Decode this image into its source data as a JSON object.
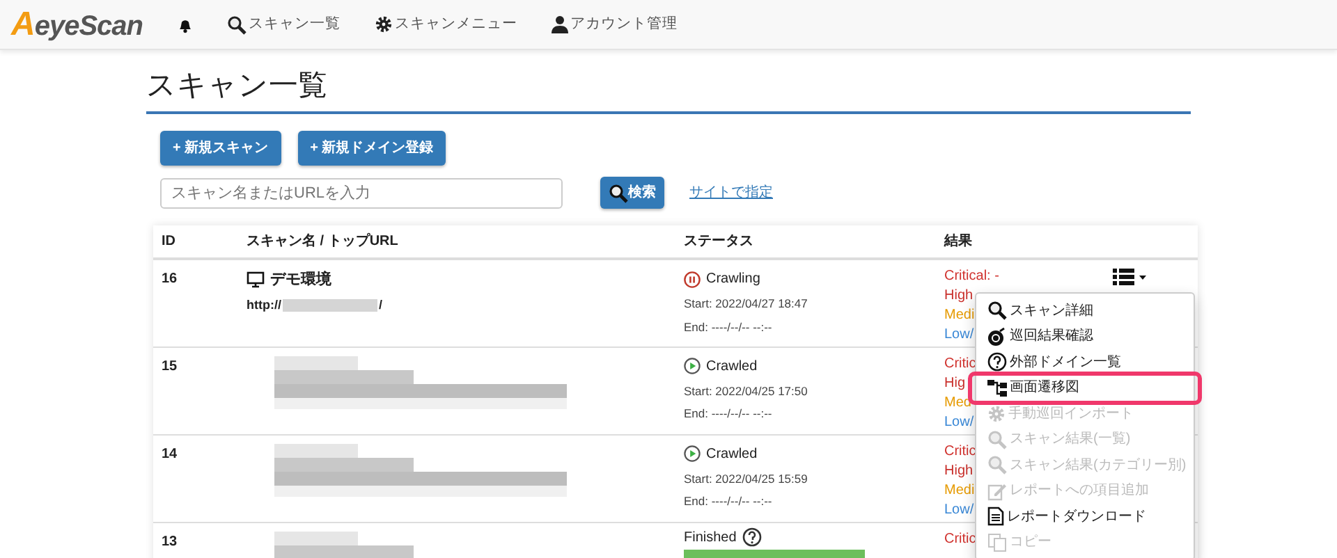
{
  "navbar": {
    "brand_mark": "A",
    "brand_rest": "eyeScan",
    "items": [
      {
        "label": "スキャン一覧"
      },
      {
        "label": "スキャンメニュー"
      },
      {
        "label": "アカウント管理"
      }
    ]
  },
  "page_title": "スキャン一覧",
  "buttons": [
    "+ 新規スキャン",
    "+ 新規ドメイン登録"
  ],
  "search": {
    "placeholder": "スキャン名またはURLを入力",
    "button": "検索",
    "link": "サイトで指定"
  },
  "table": {
    "columns": [
      "ID",
      "スキャン名 / トップURL",
      "ステータス",
      "結果"
    ],
    "rows": [
      {
        "id": "16",
        "name": "デモ環境",
        "url_prefix": "http://",
        "url_suffix": "/",
        "status": "Crawling",
        "kind": "paused",
        "start": "Start: 2022/04/27 18:47",
        "end": "End: ----/--/-- --:--",
        "results": [
          {
            "text": "Critical: -",
            "color": "#d0312d"
          },
          {
            "text": "High",
            "color": "#c9302c"
          },
          {
            "text": "Medi",
            "color": "#e69a00"
          },
          {
            "text": "Low/",
            "color": "#3a88d6"
          }
        ]
      },
      {
        "id": "15",
        "status": "Crawled",
        "kind": "running",
        "start": "Start: 2022/04/25 17:50",
        "end": "End: ----/--/-- --:--",
        "results": [
          {
            "text": "Critic",
            "color": "#d0312d"
          },
          {
            "text": "Hig",
            "color": "#c9302c"
          },
          {
            "text": "Med",
            "color": "#e69a00"
          },
          {
            "text": "Low/",
            "color": "#3a88d6"
          }
        ]
      },
      {
        "id": "14",
        "status": "Crawled",
        "kind": "running",
        "start": "Start: 2022/04/25 15:59",
        "end": "End: ----/--/-- --:--",
        "results": [
          {
            "text": "Critic",
            "color": "#d0312d"
          },
          {
            "text": "High",
            "color": "#c9302c"
          },
          {
            "text": "Medi",
            "color": "#e69a00"
          },
          {
            "text": "Low/",
            "color": "#3a88d6"
          }
        ]
      },
      {
        "id": "13",
        "status": "Finished",
        "kind": "finished",
        "level": 1,
        "results": [
          {
            "text": "Critic",
            "color": "#d0312d"
          }
        ]
      }
    ]
  },
  "row_menu": {
    "items": [
      {
        "label": "スキャン詳細",
        "disabled": false,
        "highlighted": false
      },
      {
        "label": "巡回結果確認",
        "disabled": false,
        "highlighted": false
      },
      {
        "label": "外部ドメイン一覧",
        "disabled": false,
        "highlighted": false
      },
      {
        "label": "画面遷移図",
        "disabled": false,
        "highlighted": true
      },
      {
        "label": "手動巡回インポート",
        "disabled": true,
        "highlighted": false
      },
      {
        "label": "スキャン結果(一覧)",
        "disabled": true,
        "highlighted": false
      },
      {
        "label": "スキャン結果(カテゴリー別)",
        "disabled": true,
        "highlighted": false
      },
      {
        "label": "レポートへの項目追加",
        "disabled": true,
        "highlighted": false
      },
      {
        "label": "レポートダウンロード",
        "disabled": false,
        "highlighted": false
      },
      {
        "label": "コピー",
        "disabled": true,
        "highlighted": false
      }
    ]
  }
}
